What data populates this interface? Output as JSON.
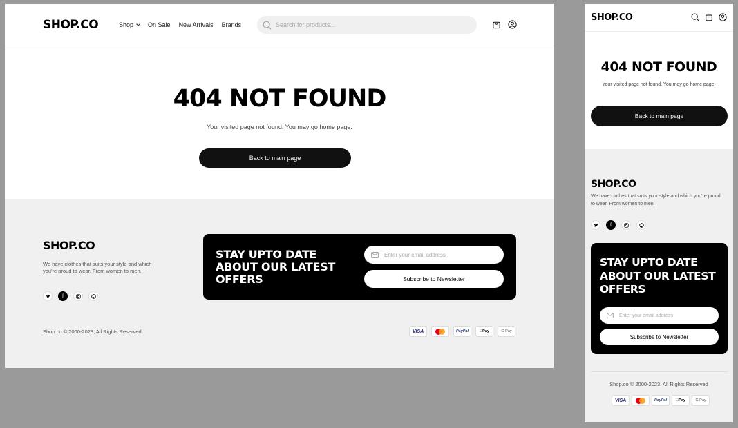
{
  "brand": {
    "logo": "SHOP.CO"
  },
  "nav": {
    "items": [
      "Shop",
      "On Sale",
      "New Arrivals",
      "Brands"
    ]
  },
  "search": {
    "placeholder": "Search for products..."
  },
  "error": {
    "title": "404 NOT FOUND",
    "message": "Your visited page not found. You may go home page.",
    "back_label": "Back to main page"
  },
  "footer": {
    "description": "We have clothes that suits your style and which you're proud to wear. From women to men.",
    "social_icons": [
      "twitter-icon",
      "facebook-icon",
      "instagram-icon",
      "github-icon"
    ],
    "newsletter": {
      "heading": "STAY UPTO DATE ABOUT OUR LATEST OFFERS",
      "email_placeholder": "Enter your email address",
      "subscribe_label": "Subscribe to Newsletter"
    },
    "copyright": "Shop.co © 2000-2023, All Rights Reserved",
    "payments": {
      "visa": "VISA",
      "mastercard": "mastercard-icon",
      "paypal": "PayPal",
      "applepay": "Pay",
      "googlepay": "G Pay"
    }
  },
  "colors": {
    "accent": "#000000",
    "footer_bg": "#f0f0f0",
    "canvas_bg": "#9a9a9a"
  }
}
